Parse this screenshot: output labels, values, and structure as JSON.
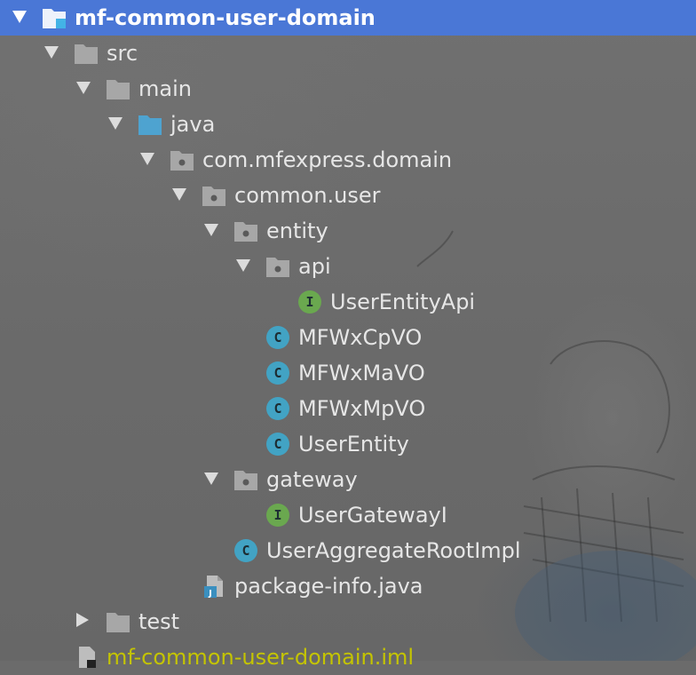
{
  "project_tree": {
    "root": {
      "label": "mf-common-user-domain",
      "icon": "module-folder-icon",
      "expanded": true,
      "selected": true
    },
    "items": [
      {
        "label": "src",
        "icon": "folder-icon",
        "expanded": true
      },
      {
        "label": "main",
        "icon": "folder-icon",
        "expanded": true
      },
      {
        "label": "java",
        "icon": "source-root-folder-icon",
        "expanded": true
      },
      {
        "label": "com.mfexpress.domain",
        "icon": "package-icon",
        "expanded": true
      },
      {
        "label": "common.user",
        "icon": "package-icon",
        "expanded": true
      },
      {
        "label": "entity",
        "icon": "package-icon",
        "expanded": true
      },
      {
        "label": "api",
        "icon": "package-icon",
        "expanded": true
      },
      {
        "label": "UserEntityApi",
        "icon": "interface-icon",
        "badge": "I"
      },
      {
        "label": "MFWxCpVO",
        "icon": "class-icon",
        "badge": "C"
      },
      {
        "label": "MFWxMaVO",
        "icon": "class-icon",
        "badge": "C"
      },
      {
        "label": "MFWxMpVO",
        "icon": "class-icon",
        "badge": "C"
      },
      {
        "label": "UserEntity",
        "icon": "class-icon",
        "badge": "C"
      },
      {
        "label": "gateway",
        "icon": "package-icon",
        "expanded": true
      },
      {
        "label": "UserGatewayI",
        "icon": "interface-icon",
        "badge": "I"
      },
      {
        "label": "UserAggregateRootImpl",
        "icon": "class-icon",
        "badge": "C"
      },
      {
        "label": "package-info.java",
        "icon": "java-file-icon"
      },
      {
        "label": "test",
        "icon": "folder-icon",
        "expanded": false
      },
      {
        "label": "mf-common-user-domain.iml",
        "icon": "iml-file-icon"
      }
    ]
  },
  "colors": {
    "selection": "#4a77d6",
    "class_badge": "#42a3c4",
    "interface_badge": "#6aa84f",
    "folder": "#a7a7a7",
    "source_root": "#4ea3d0",
    "iml_text": "#c4c400"
  }
}
